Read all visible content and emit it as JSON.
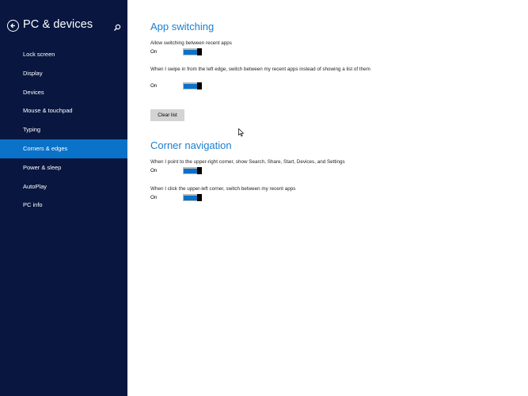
{
  "sidebar": {
    "title": "PC & devices",
    "back_icon": "back-arrow-icon",
    "search_icon": "search-icon",
    "items": [
      {
        "label": "Lock screen",
        "active": false
      },
      {
        "label": "Display",
        "active": false
      },
      {
        "label": "Devices",
        "active": false
      },
      {
        "label": "Mouse & touchpad",
        "active": false
      },
      {
        "label": "Typing",
        "active": false
      },
      {
        "label": "Corners & edges",
        "active": true
      },
      {
        "label": "Power & sleep",
        "active": false
      },
      {
        "label": "AutoPlay",
        "active": false
      },
      {
        "label": "PC info",
        "active": false
      }
    ]
  },
  "app_switching": {
    "heading": "App switching",
    "settings": [
      {
        "label": "Allow switching between recent apps",
        "state": "On",
        "on": true
      },
      {
        "label": "When I swipe in from the left edge, switch between my recent apps instead of showing a list of them",
        "state": "On",
        "on": true
      }
    ],
    "clear_button": "Clear list"
  },
  "corner_navigation": {
    "heading": "Corner navigation",
    "settings": [
      {
        "label": "When I point to the upper-right corner, show Search, Share, Start, Devices, and Settings",
        "state": "On",
        "on": true
      },
      {
        "label": "When I click the upper-left corner, switch between my recent apps",
        "state": "On",
        "on": true
      }
    ]
  },
  "colors": {
    "sidebar_bg": "#081640",
    "accent": "#0a72c8",
    "heading": "#1a7fcf"
  }
}
